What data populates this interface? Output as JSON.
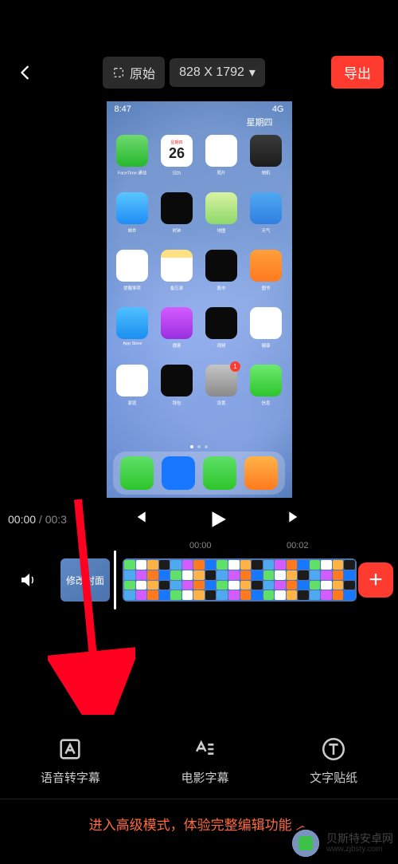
{
  "header": {
    "aspect_label": "原始",
    "resolution": "828 X 1792",
    "export_label": "导出"
  },
  "phone_preview": {
    "time": "8:47",
    "network": "4G",
    "date_day": "星期四",
    "date_num": "26",
    "apps_row1": [
      {
        "label": "FaceTime 通话",
        "color": "linear-gradient(#6fd96f,#27b72e)"
      },
      {
        "label": "日历",
        "color": "#fff"
      },
      {
        "label": "照片",
        "color": "#fff"
      },
      {
        "label": "相机",
        "color": "linear-gradient(#3a3a3a,#1c1c1c)"
      }
    ],
    "apps_row2": [
      {
        "label": "邮件",
        "color": "linear-gradient(#5bc6ff,#1f8df5)"
      },
      {
        "label": "时钟",
        "color": "#0a0a0a"
      },
      {
        "label": "地图",
        "color": "linear-gradient(#d8f3a2,#8fd86b)"
      },
      {
        "label": "天气",
        "color": "linear-gradient(#4fa9f0,#2f7fe0)"
      }
    ],
    "apps_row3": [
      {
        "label": "提醒事项",
        "color": "#fff"
      },
      {
        "label": "备忘录",
        "color": "linear-gradient(#ffe082 25%,#fff 25%)"
      },
      {
        "label": "股市",
        "color": "#0a0a0a"
      },
      {
        "label": "图书",
        "color": "linear-gradient(#ff9f3a,#ff7a1f)"
      }
    ],
    "apps_row4": [
      {
        "label": "App Store",
        "color": "linear-gradient(#4fc0ff,#1a8ff0)"
      },
      {
        "label": "播客",
        "color": "linear-gradient(#d35cff,#9a2fe0)"
      },
      {
        "label": "视频",
        "color": "#0a0a0a"
      },
      {
        "label": "健康",
        "color": "#fff"
      }
    ],
    "apps_row5": [
      {
        "label": "家庭",
        "color": "#fff"
      },
      {
        "label": "钱包",
        "color": "#0a0a0a"
      },
      {
        "label": "设置",
        "color": "linear-gradient(#c4c4c4,#8a8a8a)",
        "badge": "1"
      },
      {
        "label": "信息",
        "color": "linear-gradient(#6fe96f,#2cc52c)"
      }
    ],
    "dock": [
      {
        "color": "linear-gradient(#5fe068,#2cc52c)"
      },
      {
        "color": "#1777ff"
      },
      {
        "color": "linear-gradient(#5fe068,#2cc52c)"
      },
      {
        "color": "linear-gradient(#ffb347,#ff7a1f)"
      }
    ]
  },
  "player": {
    "current": "00:00",
    "total": "00:3",
    "ticks": [
      "00:00",
      "00:02"
    ]
  },
  "timeline": {
    "cover_label": "修改封面"
  },
  "tools": [
    {
      "id": "voice-to-subtitle",
      "label": "语音转字幕"
    },
    {
      "id": "movie-subtitle",
      "label": "电影字幕"
    },
    {
      "id": "text-sticker",
      "label": "文字贴纸"
    }
  ],
  "advanced_mode": "进入高级模式，体验完整编辑功能",
  "watermark": {
    "cn": "贝斯特安卓网",
    "en": "www.zjbsty.com"
  }
}
